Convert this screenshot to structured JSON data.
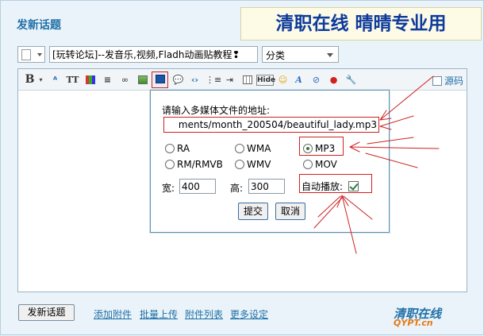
{
  "page": {
    "title": "发新话题",
    "banner": "清职在线 晴晴专业用"
  },
  "form": {
    "subject_value": "[玩转论坛]--发音乐,视频,Fladh动画贴教程❢",
    "category_label": "分类"
  },
  "toolbar": {
    "source_label": "源码",
    "hide_label": "Hide",
    "bold_label": "B",
    "fontsize_label": "TT"
  },
  "popup": {
    "prompt": "请输入多媒体文件的地址:",
    "url_value": "ments/month_200504/beautiful_lady.mp3",
    "formats": [
      "RA",
      "WMA",
      "MP3",
      "RM/RMVB",
      "WMV",
      "MOV"
    ],
    "selected_format": "MP3",
    "width_label": "宽:",
    "width_value": "400",
    "height_label": "高:",
    "height_value": "300",
    "autoplay_label": "自动播放:",
    "submit_label": "提交",
    "cancel_label": "取消"
  },
  "footer": {
    "post_button": "发新话题",
    "links": [
      "添加附件",
      "批量上传",
      "附件列表",
      "更多设定"
    ],
    "logo_text": "清职在线",
    "logo_url": "QYPT.cn"
  },
  "colors": {
    "accent": "#1f6fa7",
    "annotation": "#d02020",
    "banner_text": "#0d3a9c"
  }
}
